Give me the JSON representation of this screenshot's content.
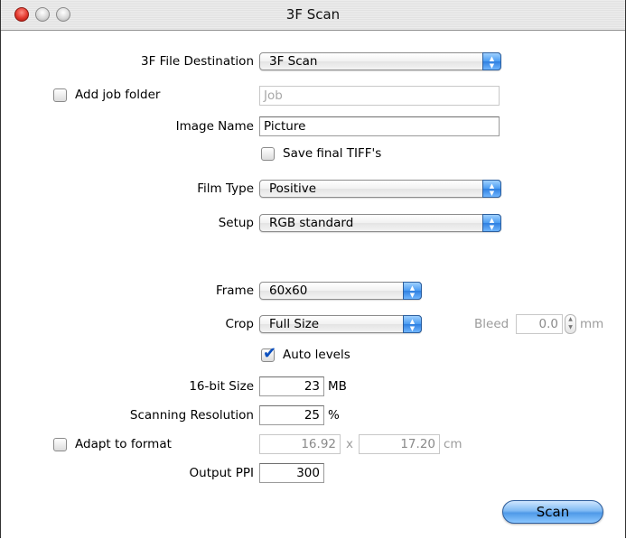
{
  "window": {
    "title": "3F Scan"
  },
  "destination": {
    "label": "3F File Destination",
    "value": "3F Scan"
  },
  "job_folder": {
    "label": "Add job folder",
    "checked": false,
    "placeholder": "Job"
  },
  "image_name": {
    "label": "Image Name",
    "value": "Picture"
  },
  "save_tiffs": {
    "label": "Save final TIFF's",
    "checked": false
  },
  "film_type": {
    "label": "Film Type",
    "value": "Positive"
  },
  "setup": {
    "label": "Setup",
    "value": "RGB standard"
  },
  "frame": {
    "label": "Frame",
    "value": "60x60"
  },
  "crop": {
    "label": "Crop",
    "value": "Full Size"
  },
  "bleed": {
    "label": "Bleed",
    "value": "0.0",
    "unit": "mm"
  },
  "auto_levels": {
    "label": "Auto levels",
    "checked": true
  },
  "size16": {
    "label": "16-bit Size",
    "value": "23",
    "unit": "MB"
  },
  "resolution": {
    "label": "Scanning Resolution",
    "value": "25",
    "unit": "%"
  },
  "adapt": {
    "label": "Adapt to format",
    "checked": false,
    "width": "16.92",
    "sep": "x",
    "height": "17.20",
    "unit": "cm"
  },
  "output_ppi": {
    "label": "Output PPI",
    "value": "300"
  },
  "scan_button": {
    "label": "Scan"
  }
}
